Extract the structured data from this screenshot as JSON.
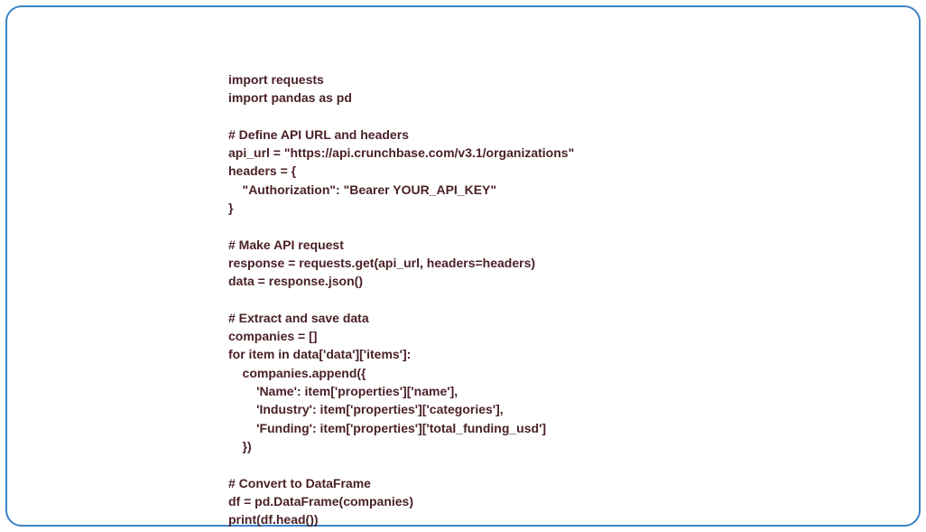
{
  "code": {
    "lines": [
      "import requests",
      "import pandas as pd",
      "",
      "# Define API URL and headers",
      "api_url = \"https://api.crunchbase.com/v3.1/organizations\"",
      "headers = {",
      "    \"Authorization\": \"Bearer YOUR_API_KEY\"",
      "}",
      "",
      "# Make API request",
      "response = requests.get(api_url, headers=headers)",
      "data = response.json()",
      "",
      "# Extract and save data",
      "companies = []",
      "for item in data['data']['items']:",
      "    companies.append({",
      "        'Name': item['properties']['name'],",
      "        'Industry': item['properties']['categories'],",
      "        'Funding': item['properties']['total_funding_usd']",
      "    })",
      "",
      "# Convert to DataFrame",
      "df = pd.DataFrame(companies)",
      "print(df.head())"
    ]
  }
}
